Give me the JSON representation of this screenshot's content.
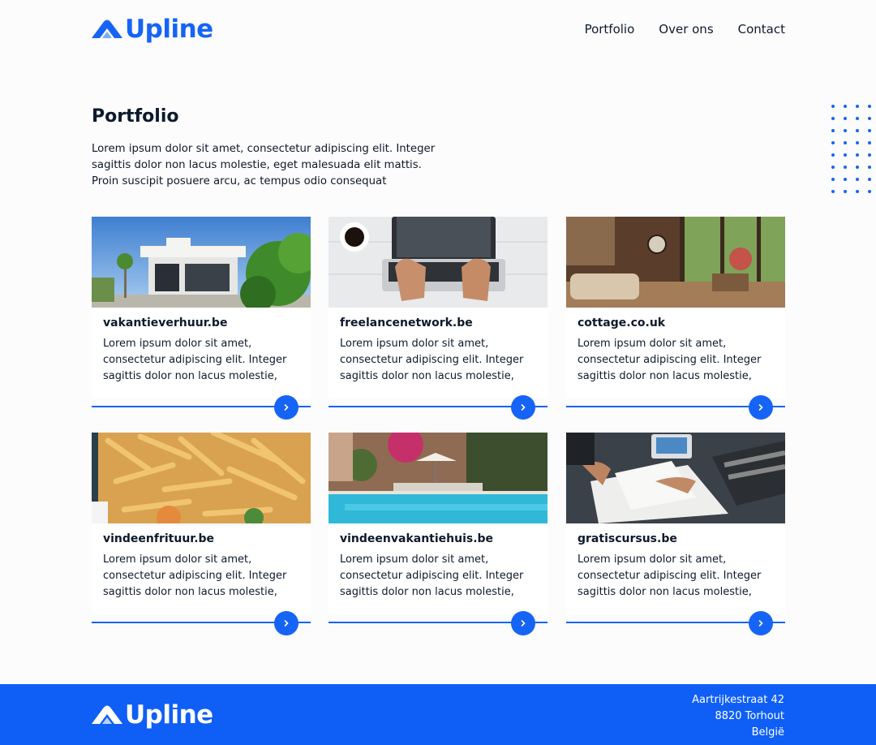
{
  "header": {
    "logo_text": "Upline",
    "nav": [
      "Portfolio",
      "Over ons",
      "Contact"
    ]
  },
  "main": {
    "title": "Portfolio",
    "intro": "Lorem ipsum dolor sit amet, consectetur adipiscing elit. Integer sagittis dolor non lacus molestie, eget malesuada elit mattis. Proin suscipit posuere arcu, ac tempus odio consequat",
    "cards": [
      {
        "title": "vakantieverhuur.be",
        "text": "Lorem ipsum dolor sit amet, consectetur adipiscing elit. Integer sagittis dolor non lacus molestie,",
        "image": "modern-white-house-photo"
      },
      {
        "title": "freelancenetwork.be",
        "text": "Lorem ipsum dolor sit amet, consectetur adipiscing elit. Integer sagittis dolor non lacus molestie,",
        "image": "laptop-typing-photo"
      },
      {
        "title": "cottage.co.uk",
        "text": "Lorem ipsum dolor sit amet, consectetur adipiscing elit. Integer sagittis dolor non lacus molestie,",
        "image": "cozy-living-room-photo"
      },
      {
        "title": "vindeenfrituur.be",
        "text": "Lorem ipsum dolor sit amet, consectetur adipiscing elit. Integer sagittis dolor non lacus molestie,",
        "image": "french-fries-photo"
      },
      {
        "title": "vindeenvakantiehuis.be",
        "text": "Lorem ipsum dolor sit amet, consectetur adipiscing elit. Integer sagittis dolor non lacus molestie,",
        "image": "pool-villa-photo"
      },
      {
        "title": "gratiscursus.be",
        "text": "Lorem ipsum dolor sit amet, consectetur adipiscing elit. Integer sagittis dolor non lacus molestie,",
        "image": "meeting-paperwork-photo"
      }
    ]
  },
  "footer": {
    "logo_text": "Upline",
    "address": [
      "Aartrijkestraat 42",
      "8820 Torhout",
      "België"
    ]
  },
  "colors": {
    "accent": "#1664f5",
    "footer_bg": "#0f5ff7",
    "text": "#0d1a2b",
    "background": "#fcfcfd"
  },
  "icons": [
    "upline-logo-icon",
    "chevron-right-icon",
    "dot-pattern"
  ]
}
